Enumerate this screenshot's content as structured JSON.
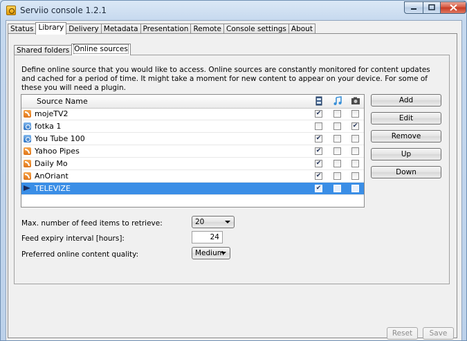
{
  "window": {
    "title": "Serviio console 1.2.1"
  },
  "tabs": [
    "Status",
    "Library",
    "Delivery",
    "Metadata",
    "Presentation",
    "Remote",
    "Console settings",
    "About"
  ],
  "active_tab": "Library",
  "subtabs": [
    "Shared folders",
    "Online sources"
  ],
  "active_subtab": "Online sources",
  "description": "Define online source that you would like to access. Online sources are constantly monitored for content updates and cached for a period of time. It might take a moment for new content to appear on your device. For some of these you will need a plugin.",
  "table": {
    "header": {
      "name": "Source Name",
      "icons": [
        "video-icon",
        "music-icon",
        "image-icon"
      ]
    },
    "rows": [
      {
        "icon": "rss-icon",
        "name": "mojeTV2",
        "video": true,
        "audio": false,
        "image": false,
        "selected": false
      },
      {
        "icon": "web-icon",
        "name": "fotka 1",
        "video": false,
        "audio": false,
        "image": true,
        "selected": false
      },
      {
        "icon": "web-icon",
        "name": "You Tube 100",
        "video": true,
        "audio": false,
        "image": false,
        "selected": false
      },
      {
        "icon": "rss-icon",
        "name": "Yahoo Pipes",
        "video": true,
        "audio": false,
        "image": false,
        "selected": false
      },
      {
        "icon": "rss-icon",
        "name": "Daily Mo",
        "video": true,
        "audio": false,
        "image": false,
        "selected": false
      },
      {
        "icon": "rss-icon",
        "name": "AnOriant",
        "video": true,
        "audio": false,
        "image": false,
        "selected": false
      },
      {
        "icon": "flag-icon",
        "name": "TELEVIZE",
        "video": true,
        "audio": false,
        "image": false,
        "selected": true
      }
    ]
  },
  "buttons": {
    "add": "Add",
    "edit": "Edit",
    "remove": "Remove",
    "up": "Up",
    "down": "Down"
  },
  "form": {
    "max_items_label": "Max. number of feed items to retrieve:",
    "max_items_value": "20",
    "expiry_label": "Feed expiry interval [hours]:",
    "expiry_value": "24",
    "quality_label": "Preferred online content quality:",
    "quality_value": "Medium"
  },
  "footer": {
    "reset": "Reset",
    "save": "Save"
  },
  "colors": {
    "selection": "#3a8ee6",
    "close_button": "#c73a22"
  }
}
